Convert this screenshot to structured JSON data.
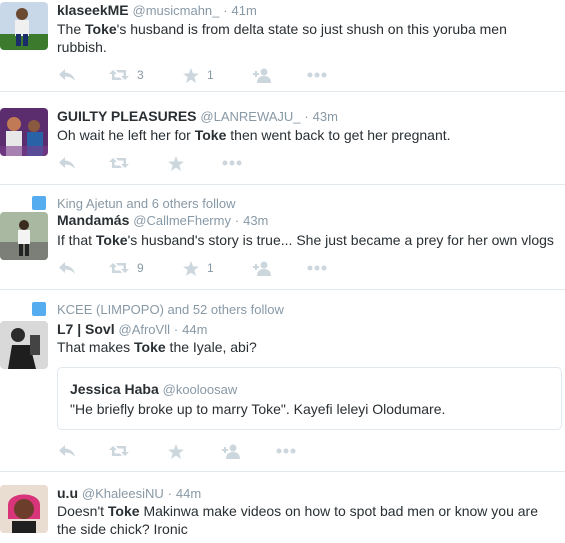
{
  "tweets": [
    {
      "name": "klaseekME",
      "handle": "@musicmahn_",
      "time": "41m",
      "text_parts": [
        "The ",
        "Toke",
        "'s husband is from delta state so just shush on this yoruba men",
        "rubbish."
      ],
      "retweets": "3",
      "favorites": "1"
    },
    {
      "name": "GUILTY PLEASURES",
      "handle": "@LANREWAJU_",
      "time": "43m",
      "text_parts": [
        "Oh wait he left her for ",
        "Toke",
        " then went back to get her pregnant."
      ]
    },
    {
      "context": "King Ajetun and 6 others follow",
      "name": "Mandamás",
      "handle": "@CallmeFhermy",
      "time": "43m",
      "text_parts": [
        "If that ",
        "Toke",
        "'s husband's story is true... She just became a prey for her own vlogs"
      ],
      "retweets": "9",
      "favorites": "1"
    },
    {
      "context": "KCEE (LIMPOPO) and 52 others follow",
      "name": "L7 | Sovl",
      "handle": "@AfroVll",
      "time": "44m",
      "text_parts": [
        "That makes ",
        "Toke",
        " the Iyale, abi?"
      ],
      "quote": {
        "name": "Jessica Haba",
        "handle": "@kooloosaw",
        "text": "\"He briefly broke up to marry Toke\". Kayefi leleyi Olodumare."
      }
    },
    {
      "name": "u.u",
      "handle": "@KhaleesiNU",
      "time": "44m",
      "text_parts": [
        "Doesn't ",
        "Toke",
        " Makinwa make videos on how to spot bad men or know you are",
        "the side chick? Ironic"
      ]
    }
  ],
  "separator": "·",
  "icons": {
    "reply": "reply-icon",
    "retweet": "retweet-icon",
    "favorite": "star-icon",
    "follow": "follow-icon",
    "more": "more-icon",
    "context": "follow-context-icon"
  },
  "colors": {
    "icon": "#ccd6dd",
    "meta": "#8899a6",
    "text": "#292f33",
    "border": "#e1e8ed",
    "context_icon": "#55acee"
  }
}
